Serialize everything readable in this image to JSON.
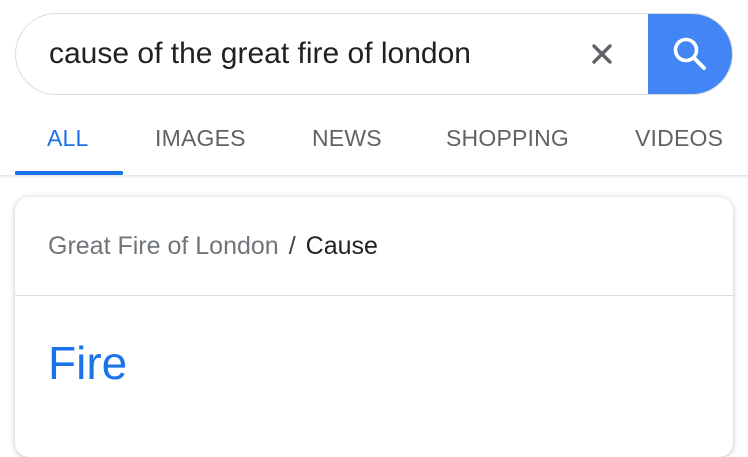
{
  "search": {
    "query": "cause of the great fire of london",
    "clear_icon": "close-icon",
    "submit_icon": "search-icon",
    "accent_color": "#4285f4"
  },
  "tabs": [
    {
      "label": "ALL",
      "active": true
    },
    {
      "label": "IMAGES",
      "active": false
    },
    {
      "label": "NEWS",
      "active": false
    },
    {
      "label": "SHOPPING",
      "active": false
    },
    {
      "label": "VIDEOS",
      "active": false
    }
  ],
  "result": {
    "breadcrumb": {
      "parent": "Great Fire of London",
      "separator": "/",
      "current": "Cause"
    },
    "answer": "Fire",
    "answer_color": "#1a73e8"
  }
}
